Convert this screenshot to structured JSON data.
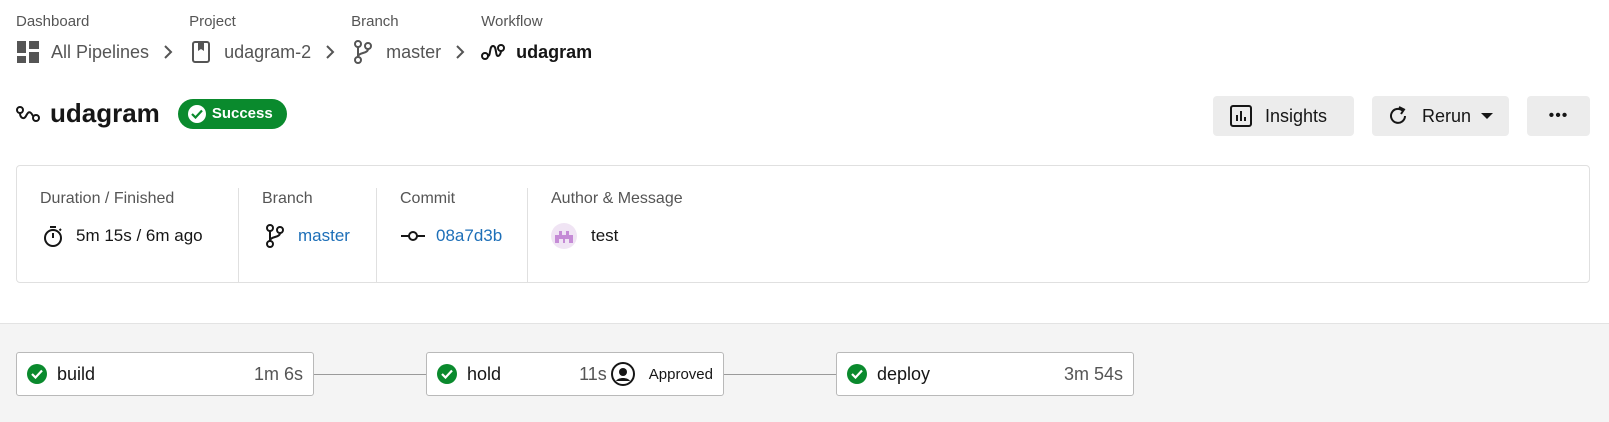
{
  "breadcrumb": [
    {
      "label": "Dashboard",
      "value": "All Pipelines",
      "icon": "grid-icon"
    },
    {
      "label": "Project",
      "value": "udagram-2",
      "icon": "bookmark-icon"
    },
    {
      "label": "Branch",
      "value": "master",
      "icon": "branch-icon"
    },
    {
      "label": "Workflow",
      "value": "udagram",
      "icon": "workflow-icon"
    }
  ],
  "header": {
    "title": "udagram",
    "status": "Success",
    "status_color": "#0a8a2d",
    "insights_label": "Insights",
    "rerun_label": "Rerun",
    "more_label": "•••"
  },
  "summary": {
    "duration_label": "Duration / Finished",
    "duration_value": "5m 15s / 6m ago",
    "branch_label": "Branch",
    "branch_value": "master",
    "commit_label": "Commit",
    "commit_value": "08a7d3b",
    "author_label": "Author & Message",
    "author_value": "test",
    "link_color": "#1d6fb8"
  },
  "jobs": [
    {
      "name": "build",
      "duration": "1m 6s",
      "status": "success"
    },
    {
      "name": "hold",
      "duration": "11s",
      "status": "success",
      "approval": "Approved"
    },
    {
      "name": "deploy",
      "duration": "3m 54s",
      "status": "success"
    }
  ]
}
